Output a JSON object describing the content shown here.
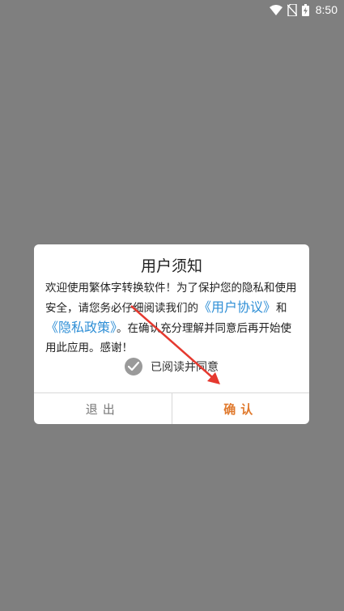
{
  "status_bar": {
    "time": "8:50",
    "icons": [
      "wifi-icon",
      "no-sim-icon",
      "battery-charging-icon"
    ]
  },
  "dialog": {
    "title": "用户须知",
    "body_part1": "欢迎使用繁体字转换软件！为了保护您的隐私和使用安全，请您务必仔细阅读我们的",
    "user_agreement_link": "《用户协议》",
    "and_text": "和",
    "privacy_policy_link": "《隐私政策》",
    "body_part2": "。在确认充分理解并同意后再开始使用此应用。感谢！",
    "agree_label": "已阅读并同意",
    "agree_checked": true,
    "exit_button": "退出",
    "confirm_button": "确认"
  },
  "colors": {
    "overlay": "#7f7f7f",
    "link": "#2f8fd6",
    "confirm": "#e07a2e",
    "annotation_arrow": "#e5392f"
  }
}
